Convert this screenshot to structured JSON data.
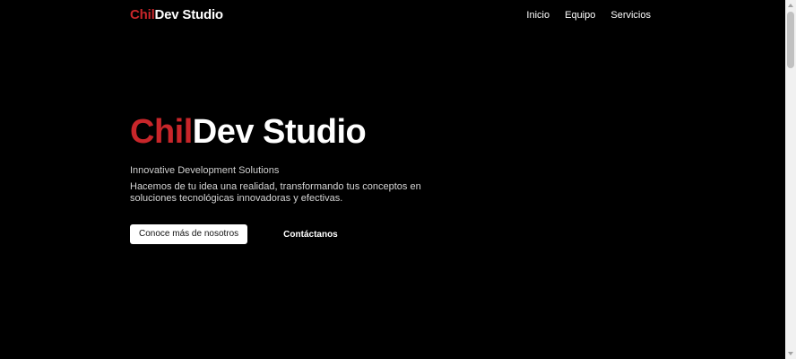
{
  "colors": {
    "background": "#000000",
    "accent": "#c8262a",
    "text": "#ffffff",
    "button_bg": "#ffffff"
  },
  "header": {
    "logo": {
      "accent": "Chil",
      "rest": "Dev Studio"
    },
    "nav": [
      {
        "label": "Inicio"
      },
      {
        "label": "Equipo"
      },
      {
        "label": "Servicios"
      }
    ]
  },
  "hero": {
    "title": {
      "accent": "Chil",
      "rest": "Dev Studio"
    },
    "subtitle": "Innovative Development Solutions",
    "description": "Hacemos de tu idea una realidad, transformando tus conceptos en soluciones tecnológicas innovadoras y efectivas.",
    "primary_button": "Conoce más de nosotros",
    "secondary_button": "Contáctanos"
  }
}
